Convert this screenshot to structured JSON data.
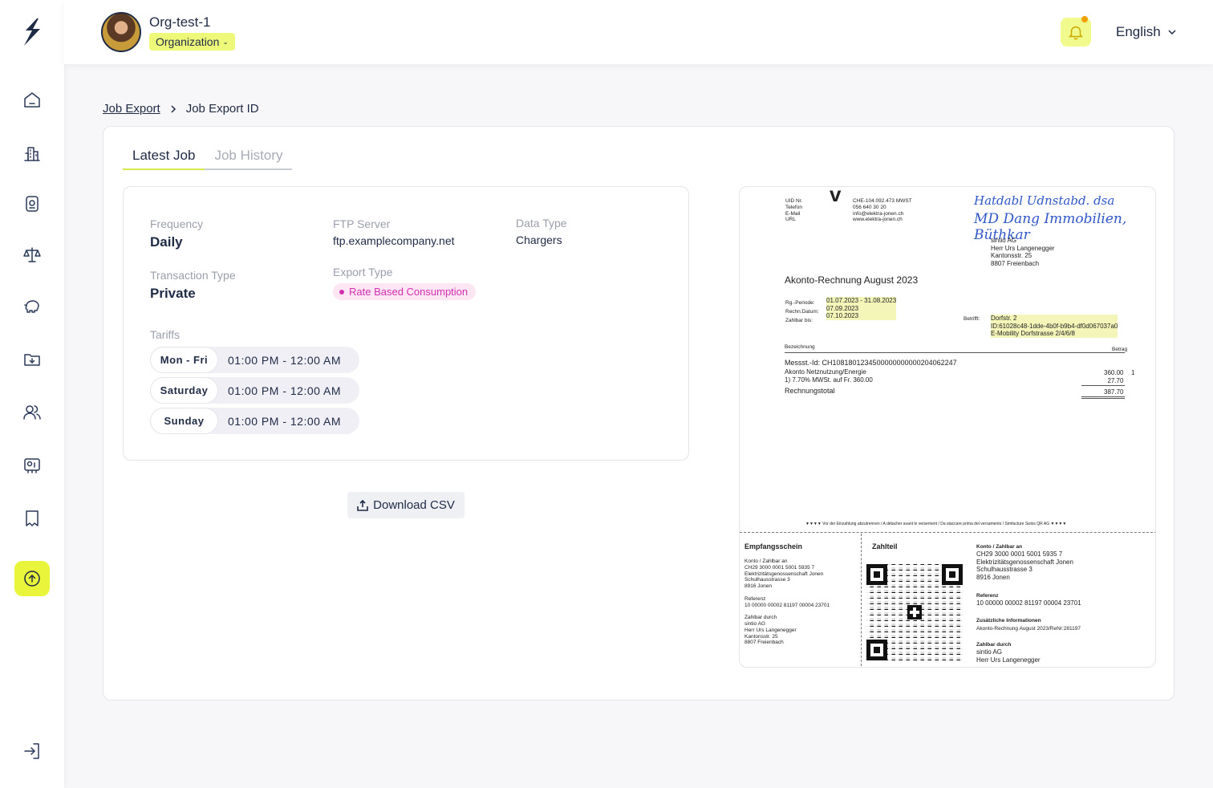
{
  "sidebar": {
    "items": [
      {
        "name": "home-icon"
      },
      {
        "name": "building-icon"
      },
      {
        "name": "charger-icon"
      },
      {
        "name": "scale-icon"
      },
      {
        "name": "piggy-bank-icon"
      },
      {
        "name": "folder-download-icon"
      },
      {
        "name": "users-icon"
      },
      {
        "name": "id-card-icon"
      },
      {
        "name": "receipt-icon"
      },
      {
        "name": "upload-icon"
      }
    ],
    "active": "upload-icon",
    "bottom": "logout-icon",
    "accent": "#e8f53a"
  },
  "header": {
    "org_name": "Org-test-1",
    "org_type": "Organization",
    "language": "English"
  },
  "breadcrumb": {
    "root": "Job Export",
    "current": "Job Export ID"
  },
  "tabs": [
    "Latest Job",
    "Job History"
  ],
  "details": {
    "frequency_label": "Frequency",
    "frequency": "Daily",
    "ftp_label": "FTP Server",
    "ftp": "ftp.examplecompany.net",
    "data_type_label": "Data Type",
    "data_type": "Chargers",
    "transaction_type_label": "Transaction Type",
    "transaction_type": "Private",
    "export_type_label": "Export Type",
    "export_type": "Rate Based Consumption",
    "tariffs_label": "Tariffs",
    "tariffs": [
      {
        "day": "Mon - Fri",
        "time": "01:00 PM - 12:00 AM"
      },
      {
        "day": "Saturday",
        "time": "01:00 PM - 12:00 AM"
      },
      {
        "day": "Sunday",
        "time": "01:00 PM - 12:00 AM"
      }
    ]
  },
  "download_label": "Download CSV",
  "document": {
    "sender_labels": "UID Nr.\nTelefon\nE-Mail\nURL",
    "sender_values": "CHE-104.092.473 MWST\n056 640 30 20\ninfo@elektra-jonen.ch\nwww.elektra-jonen.ch",
    "handwriting_1": "Hatdabl Udnstabd. dsa",
    "handwriting_2": "MD Dang Immobilien, Büthkar",
    "recipient": "sintio AG\nHerr Urs Langenegger\nKantonsstr. 25\n8807 Freienbach",
    "title": "Akonto-Rechnung August 2023",
    "meta_labels": "Rg.-Periode:\nRechn.Datum:\nZahlbar bis:",
    "meta_values": "01.07.2023 - 31.08.2023\n07.09.2023\n07.10.2023",
    "betrifft_label": "Betrifft:",
    "betrifft": "Dorfstr. 2\nID:61028c48-1dde-4b0f-b9b4-df0d067037a0\nE-Mobility Dorfstrasse 2/4/6/8",
    "col_left": "Bezeichnung",
    "col_right": "Betrag",
    "messst": "Messst.-Id: CH1081801234500000000000204062247",
    "line_items": "Akonto Netznutzung/Energie\n1) 7.70% MWSt. auf Fr. 360.00",
    "line_amounts": "360.00\n27.70",
    "line_code": "1",
    "total_label": "Rechnungstotal",
    "total": "387.70",
    "separator": "▼▼▼▼ Vor der Einzahlung abzutrennen / A détacher avant le versement / Da staccare prima del versamento / Simfacture Swiss QR AG ▼▼▼▼",
    "receipt_title": "Empfangsschein",
    "receipt_body": "Konto / Zahlbar an\nCH29 3000 0001 5001 5935 7\nElektrizitätsgenossenschaft Jonen\nSchulhausstrasse 3\n8916 Jonen\n\nReferenz\n10 00000 00002 81197 00004 23701\n\nZahlbar durch\nsintio AG\nHerr Urs Langenegger\nKantonsstr. 25\n8807 Freienbach",
    "payment_title": "Zahlteil",
    "payment_account_label": "Konto / Zahlbar an",
    "payment_account": "CH29 3000 0001 5001 5935 7\nElektrizitätsgenossenschaft Jonen\nSchulhausstrasse 3\n8916 Jonen",
    "payment_ref_label": "Referenz",
    "payment_ref": "10 00000 00002 81197 00004 23701",
    "payment_info_label": "Zusätzliche Informationen",
    "payment_info": "Akonto-Rechnung August 2023/ReNr:281197",
    "payment_payer_label": "Zahlbar durch",
    "payment_payer": "sintio AG\nHerr Urs Langenegger"
  }
}
